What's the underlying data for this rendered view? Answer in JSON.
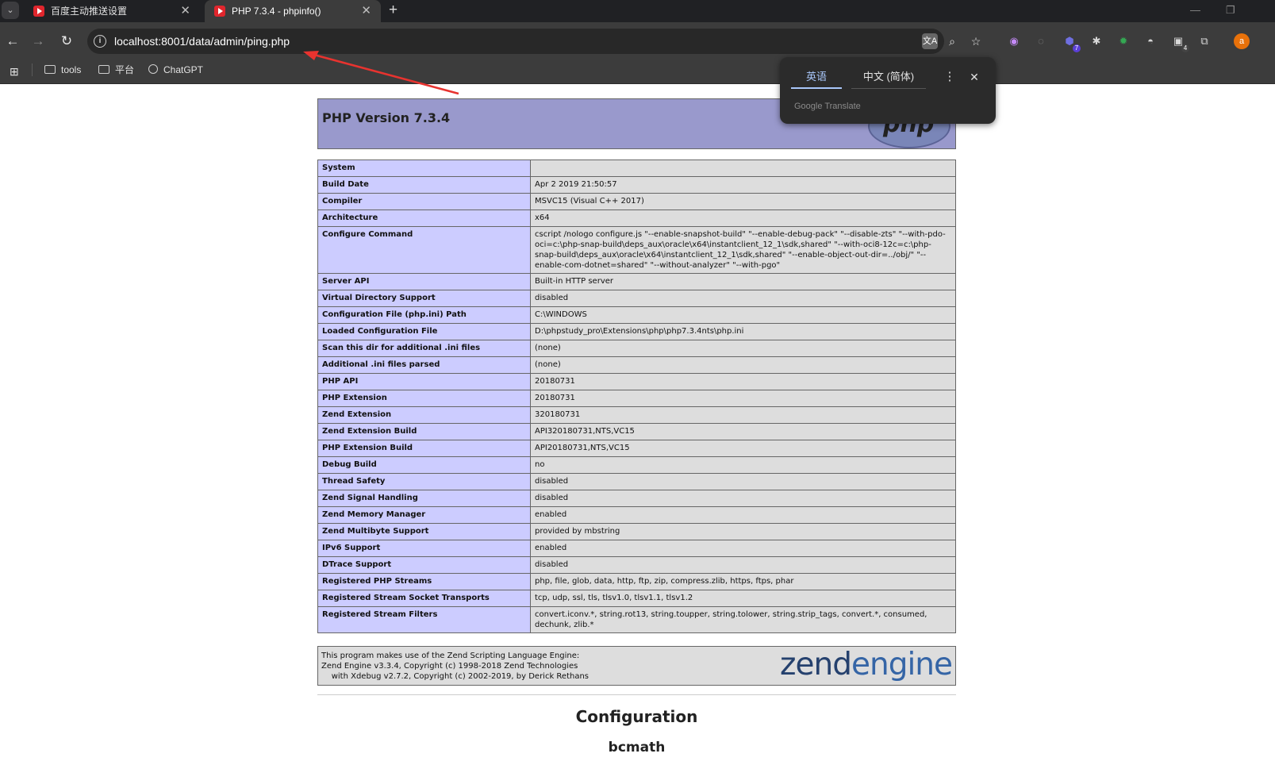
{
  "browser": {
    "tabs": [
      {
        "title": "百度主动推送设置",
        "close": "✕"
      },
      {
        "title": "PHP 7.3.4 - phpinfo()",
        "close": "✕"
      }
    ],
    "new_tab": "+",
    "window_controls": {
      "minimize": "—",
      "restore": "❐"
    },
    "url": "localhost:8001/data/admin/ping.php",
    "nav": {
      "back": "←",
      "forward": "→",
      "reload": "↻"
    },
    "omnibox_icons": [
      "translate-icon",
      "zoom-icon",
      "star-icon"
    ],
    "extensions": [
      {
        "name": "ring-ext-icon",
        "glyph": "◉",
        "color": "#c58af9"
      },
      {
        "name": "loop-ext-icon",
        "glyph": "◌"
      },
      {
        "name": "badge-ext-icon",
        "glyph": "⬢",
        "badge": "7"
      },
      {
        "name": "bug-ext-icon",
        "glyph": "✱"
      },
      {
        "name": "gear-ext-icon",
        "glyph": "✹",
        "color": "#34a853"
      },
      {
        "name": "mask-ext-icon",
        "glyph": "◓"
      },
      {
        "name": "tile-ext-icon",
        "glyph": "▣",
        "badge": "4"
      },
      {
        "name": "puzzle-icon",
        "glyph": "⧉"
      }
    ],
    "profile_initial": "a",
    "bookmarks": [
      {
        "label": "tools"
      },
      {
        "label": "平台"
      },
      {
        "label": "ChatGPT"
      }
    ]
  },
  "translate_popup": {
    "source_lang": "英语",
    "target_lang": "中文 (简体)",
    "brand": "Google Translate"
  },
  "phpinfo": {
    "title": "PHP Version 7.3.4",
    "logo_text": "php",
    "rows": [
      {
        "key": "System",
        "value": ""
      },
      {
        "key": "Build Date",
        "value": "Apr 2 2019 21:50:57"
      },
      {
        "key": "Compiler",
        "value": "MSVC15 (Visual C++ 2017)"
      },
      {
        "key": "Architecture",
        "value": "x64"
      },
      {
        "key": "Configure Command",
        "value": "cscript /nologo configure.js \"--enable-snapshot-build\" \"--enable-debug-pack\" \"--disable-zts\" \"--with-pdo-oci=c:\\php-snap-build\\deps_aux\\oracle\\x64\\instantclient_12_1\\sdk,shared\" \"--with-oci8-12c=c:\\php-snap-build\\deps_aux\\oracle\\x64\\instantclient_12_1\\sdk,shared\" \"--enable-object-out-dir=../obj/\" \"--enable-com-dotnet=shared\" \"--without-analyzer\" \"--with-pgo\""
      },
      {
        "key": "Server API",
        "value": "Built-in HTTP server"
      },
      {
        "key": "Virtual Directory Support",
        "value": "disabled"
      },
      {
        "key": "Configuration File (php.ini) Path",
        "value": "C:\\WINDOWS"
      },
      {
        "key": "Loaded Configuration File",
        "value": "D:\\phpstudy_pro\\Extensions\\php\\php7.3.4nts\\php.ini"
      },
      {
        "key": "Scan this dir for additional .ini files",
        "value": "(none)"
      },
      {
        "key": "Additional .ini files parsed",
        "value": "(none)"
      },
      {
        "key": "PHP API",
        "value": "20180731"
      },
      {
        "key": "PHP Extension",
        "value": "20180731"
      },
      {
        "key": "Zend Extension",
        "value": "320180731"
      },
      {
        "key": "Zend Extension Build",
        "value": "API320180731,NTS,VC15"
      },
      {
        "key": "PHP Extension Build",
        "value": "API20180731,NTS,VC15"
      },
      {
        "key": "Debug Build",
        "value": "no"
      },
      {
        "key": "Thread Safety",
        "value": "disabled"
      },
      {
        "key": "Zend Signal Handling",
        "value": "disabled"
      },
      {
        "key": "Zend Memory Manager",
        "value": "enabled"
      },
      {
        "key": "Zend Multibyte Support",
        "value": "provided by mbstring"
      },
      {
        "key": "IPv6 Support",
        "value": "enabled"
      },
      {
        "key": "DTrace Support",
        "value": "disabled"
      },
      {
        "key": "Registered PHP Streams",
        "value": "php, file, glob, data, http, ftp, zip, compress.zlib, https, ftps, phar"
      },
      {
        "key": "Registered Stream Socket Transports",
        "value": "tcp, udp, ssl, tls, tlsv1.0, tlsv1.1, tlsv1.2"
      },
      {
        "key": "Registered Stream Filters",
        "value": "convert.iconv.*, string.rot13, string.toupper, string.tolower, string.strip_tags, convert.*, consumed, dechunk, zlib.*"
      }
    ],
    "zend": {
      "line1": "This program makes use of the Zend Scripting Language Engine:",
      "line2": "Zend Engine v3.3.4, Copyright (c) 1998-2018 Zend Technologies",
      "line3": "    with Xdebug v2.7.2, Copyright (c) 2002-2019, by Derick Rethans",
      "logo_left": "zend",
      "logo_right": "engine"
    },
    "section_heading": "Configuration",
    "module_heading": "bcmath"
  },
  "colors": {
    "header_bg": "#9999cc",
    "key_bg": "#ccccff",
    "value_bg": "#dddddd",
    "annotation_arrow": "#e8332f"
  }
}
